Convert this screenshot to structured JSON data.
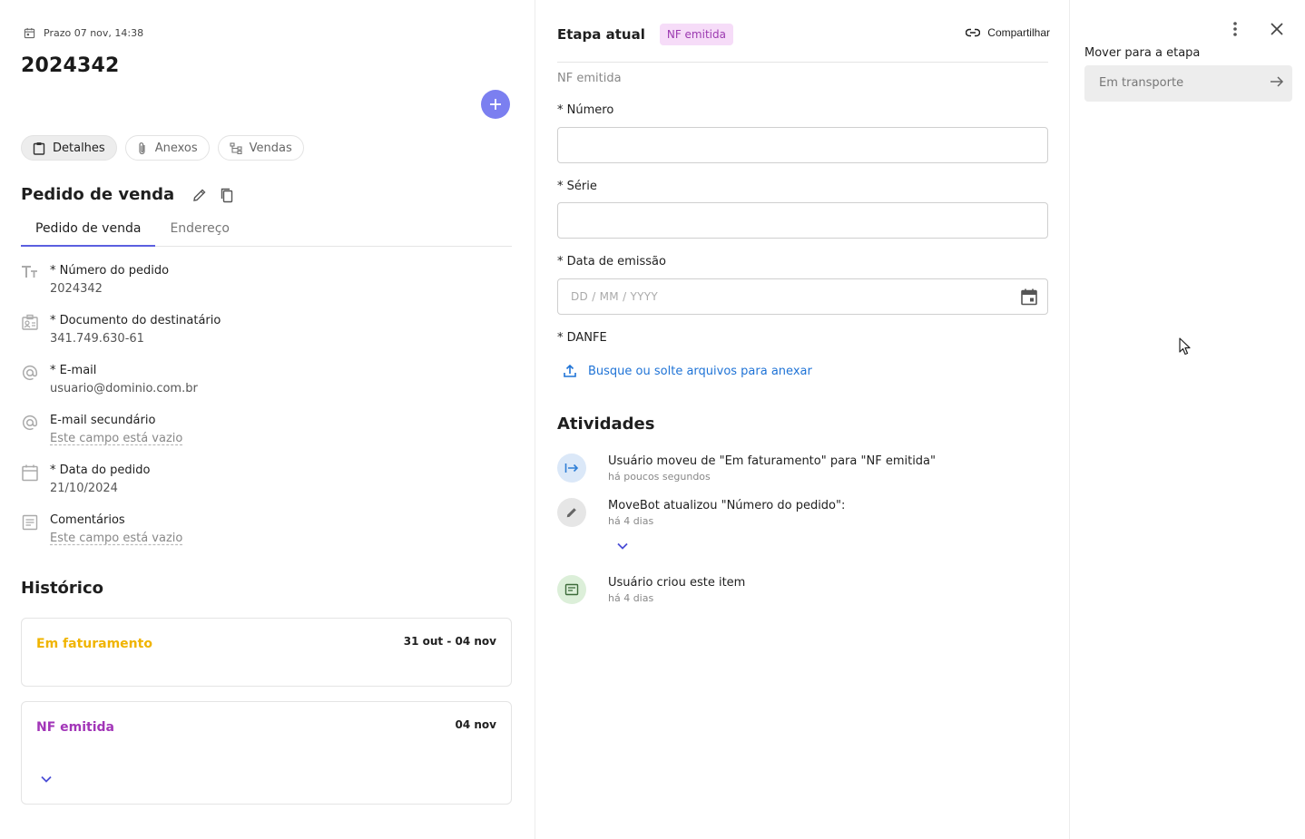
{
  "header": {
    "deadline": "Prazo 07 nov, 14:38",
    "title": "2024342"
  },
  "nav_tabs": [
    "Detalhes",
    "Anexos",
    "Vendas"
  ],
  "section": {
    "title": "Pedido de venda",
    "tabs": [
      "Pedido de venda",
      "Endereço"
    ]
  },
  "fields": [
    {
      "label": "* Número do pedido",
      "value": "2024342",
      "icon": "text-type-icon"
    },
    {
      "label": "* Documento do destinatário",
      "value": "341.749.630-61",
      "icon": "id-card-icon"
    },
    {
      "label": "* E-mail",
      "value": "usuario@dominio.com.br",
      "icon": "at-icon"
    },
    {
      "label": "E-mail secundário",
      "value": "Este campo está vazio",
      "icon": "at-icon"
    },
    {
      "label": "* Data do pedido",
      "value": "21/10/2024",
      "icon": "calendar-icon"
    },
    {
      "label": "Comentários",
      "value": "Este campo está vazio",
      "icon": "notes-icon"
    }
  ],
  "history": {
    "title": "Histórico",
    "items": [
      {
        "name": "Em faturamento",
        "date": "31 out - 04 nov",
        "color": "#f0b400"
      },
      {
        "name": "NF emitida",
        "date": "04 nov",
        "color": "#a235b8"
      }
    ]
  },
  "stage": {
    "label": "Etapa atual",
    "badge": "NF emitida",
    "share": "Compartilhar",
    "form_title": "NF emitida",
    "fields": {
      "numero": "* Número",
      "serie": "* Série",
      "data": "* Data de emissão",
      "danfe": "* DANFE"
    },
    "date_placeholder": "DD / MM / YYYY",
    "upload": "Busque ou solte arquivos para anexar"
  },
  "activities": {
    "title": "Atividades",
    "items": [
      {
        "text": "Usuário moveu de \"Em faturamento\" para \"NF emitida\"",
        "time": "há poucos segundos",
        "icon": "move-arrow-icon"
      },
      {
        "text": "MoveBot atualizou \"Número do pedido\":",
        "time": "há 4 dias",
        "icon": "pencil-icon"
      },
      {
        "text": "Usuário criou este item",
        "time": "há 4 dias",
        "icon": "card-icon"
      }
    ]
  },
  "move": {
    "label": "Mover para a etapa",
    "placeholder": "Em transporte"
  },
  "colors": {
    "accent": "#7b7ff0",
    "link": "#1f73d6",
    "badge_bg": "#f6dcf8",
    "badge_fg": "#9c3ab0"
  }
}
